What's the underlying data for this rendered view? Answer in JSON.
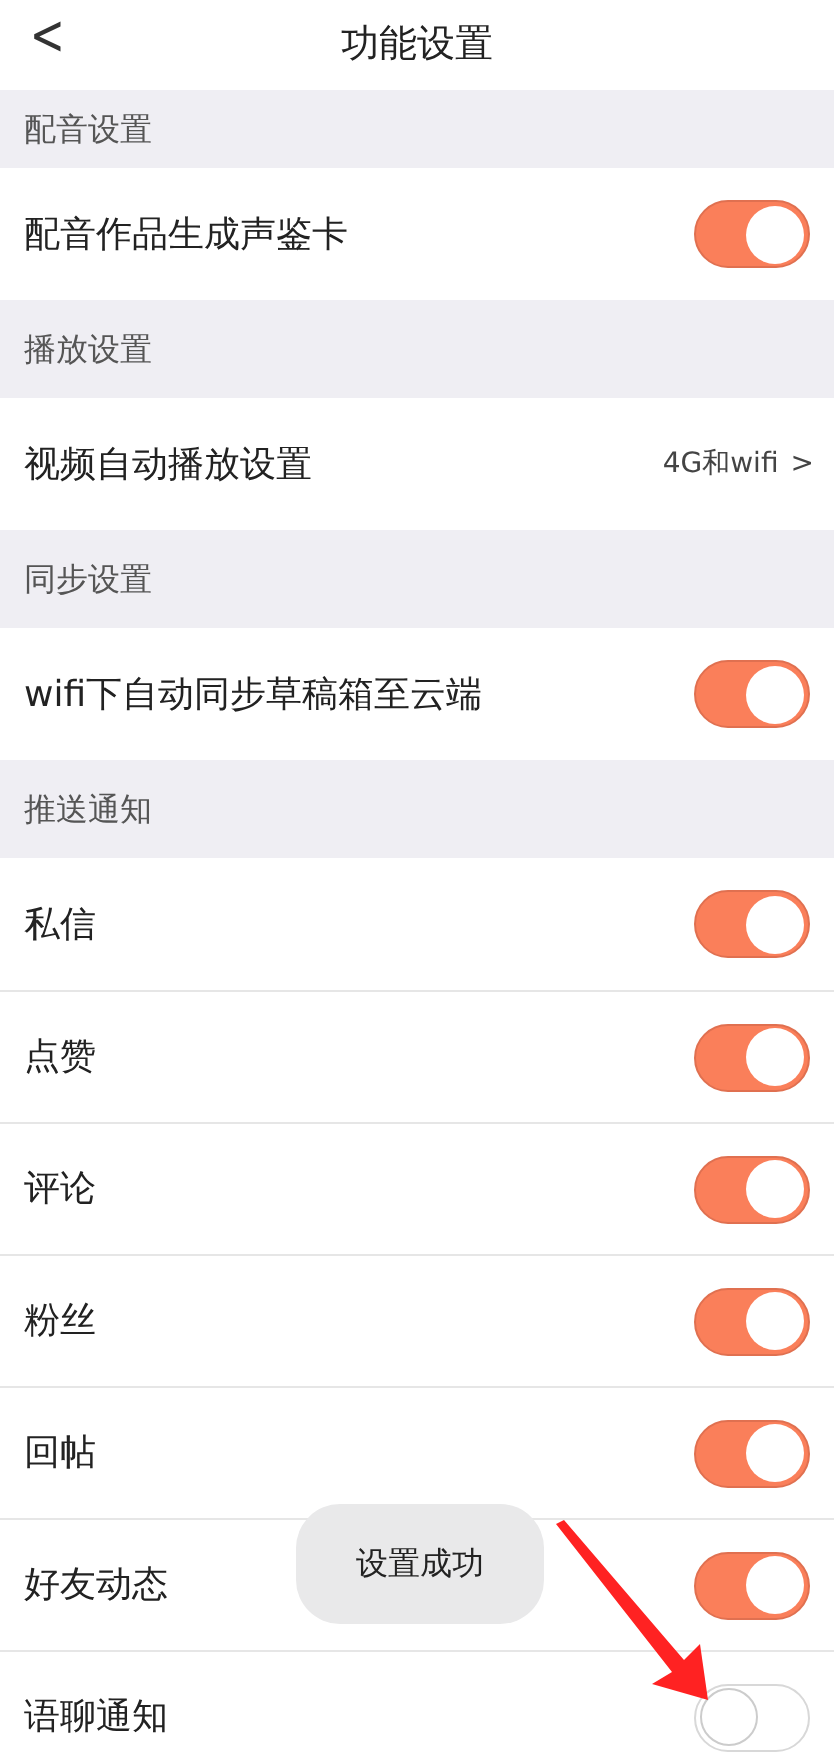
{
  "header": {
    "back": "<",
    "title": "功能设置"
  },
  "sections": [
    {
      "title": "配音设置",
      "rows": [
        {
          "kind": "toggle",
          "label": "配音作品生成声鉴卡",
          "on": true
        }
      ]
    },
    {
      "title": "播放设置",
      "rows": [
        {
          "kind": "link",
          "label": "视频自动播放设置",
          "value": "4G和wifi",
          "chevron": ">"
        }
      ]
    },
    {
      "title": "同步设置",
      "rows": [
        {
          "kind": "toggle",
          "label": "wifi下自动同步草稿箱至云端",
          "on": true
        }
      ]
    },
    {
      "title": "推送通知",
      "rows": [
        {
          "kind": "toggle",
          "label": "私信",
          "on": true
        },
        {
          "kind": "toggle",
          "label": "点赞",
          "on": true
        },
        {
          "kind": "toggle",
          "label": "评论",
          "on": true
        },
        {
          "kind": "toggle",
          "label": "粉丝",
          "on": true
        },
        {
          "kind": "toggle",
          "label": "回帖",
          "on": true
        },
        {
          "kind": "toggle",
          "label": "好友动态",
          "on": true
        },
        {
          "kind": "toggle",
          "label": "语聊通知",
          "on": false
        }
      ]
    }
  ],
  "toast": "设置成功"
}
